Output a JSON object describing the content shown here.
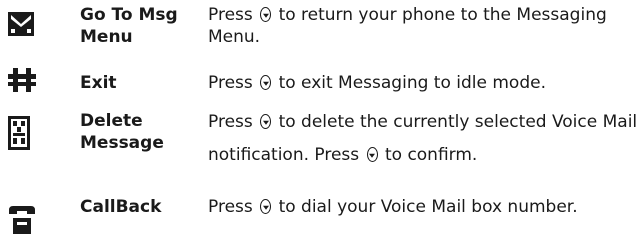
{
  "rows": [
    {
      "icon": "go-to-msg-menu-icon",
      "label": "Go To Msg Menu",
      "desc_before": "Press",
      "desc_after": "to return your phone to the Messaging Menu."
    },
    {
      "icon": "exit-icon",
      "label": "Exit",
      "desc_before": "Press",
      "desc_after": "to exit Messaging to idle mode."
    },
    {
      "icon": "delete-icon",
      "label": "Delete Message",
      "desc_before": "Press",
      "desc_middle": "to delete the currently selected Voice Mail notification. Press",
      "desc_after": "to confirm."
    },
    {
      "icon": "phone-icon",
      "label": "CallBack",
      "desc_before": "Press",
      "desc_after": "to dial your Voice Mail box number."
    }
  ]
}
